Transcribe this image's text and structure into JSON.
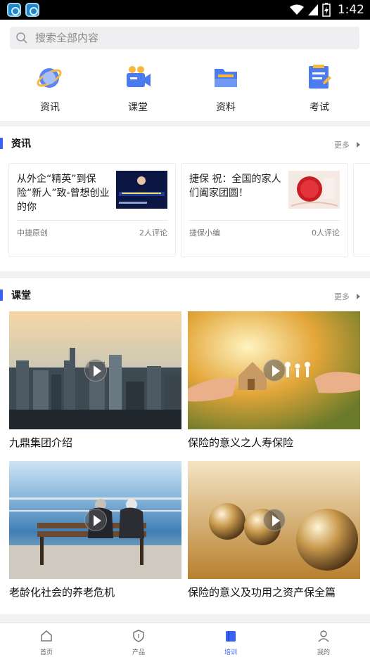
{
  "status_bar": {
    "time": "1:42"
  },
  "search": {
    "placeholder": "搜索全部内容"
  },
  "categories": [
    {
      "label": "资讯",
      "icon": "globe-icon"
    },
    {
      "label": "课堂",
      "icon": "video-camera-icon"
    },
    {
      "label": "资料",
      "icon": "folder-icon"
    },
    {
      "label": "考试",
      "icon": "clipboard-icon"
    }
  ],
  "news": {
    "title": "资讯",
    "more": "更多",
    "cards": [
      {
        "title": "从外企“精英”到保险“新人”致-曾想创业的你",
        "author": "中捷原创",
        "comments": "2人评论"
      },
      {
        "title": "捷保  祝：全国的家人们阖家团圆！",
        "author": "捷保小编",
        "comments": "0人评论"
      }
    ]
  },
  "classroom": {
    "title": "课堂",
    "more": "更多",
    "courses": [
      {
        "title": "九鼎集团介绍"
      },
      {
        "title": "保险的意义之人寿保险"
      },
      {
        "title": "老龄化社会的养老危机"
      },
      {
        "title": "保险的意义及功用之资产保全篇"
      }
    ]
  },
  "tabbar": {
    "items": [
      {
        "label": "首页",
        "icon": "home-icon"
      },
      {
        "label": "产品",
        "icon": "shield-icon"
      },
      {
        "label": "培训",
        "icon": "book-icon"
      },
      {
        "label": "我的",
        "icon": "user-icon"
      }
    ],
    "active": "培训"
  },
  "colors": {
    "accent": "#3a62f5",
    "section_bar": "#3a62f5",
    "icon_blue": "#4a7cf0"
  }
}
